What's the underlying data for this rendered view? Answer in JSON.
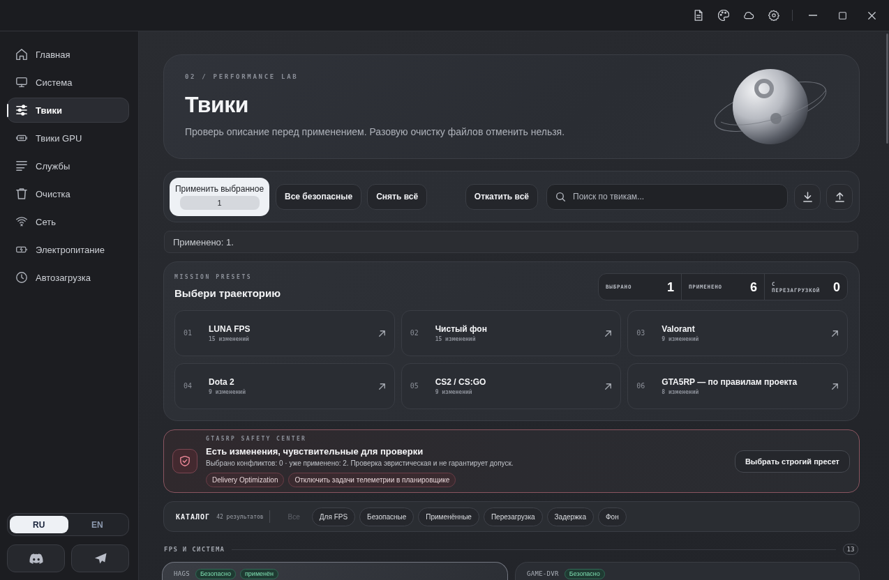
{
  "sidebar": {
    "items": [
      {
        "label": "Главная",
        "selected": false
      },
      {
        "label": "Система",
        "selected": false
      },
      {
        "label": "Твики",
        "selected": true
      },
      {
        "label": "Твики GPU",
        "selected": false
      },
      {
        "label": "Службы",
        "selected": false
      },
      {
        "label": "Очистка",
        "selected": false
      },
      {
        "label": "Сеть",
        "selected": false
      },
      {
        "label": "Электропитание",
        "selected": false
      },
      {
        "label": "Автозагрузка",
        "selected": false
      }
    ],
    "languages": [
      {
        "label": "RU",
        "selected": true
      },
      {
        "label": "EN",
        "selected": false
      }
    ]
  },
  "hero": {
    "eyebrow": "02 / PERFORMANCE LAB",
    "title": "Твики",
    "subtitle": "Проверь описание перед применением. Разовую очистку файлов отменить нельзя."
  },
  "toolbar": {
    "apply_button": {
      "label": "Применить выбранное",
      "count": "1"
    },
    "buttons": [
      "Все безопасные",
      "Снять всё"
    ],
    "revert_button": "Откатить всё",
    "search": {
      "placeholder": "Поиск по твикам..."
    }
  },
  "status_bar": "Применено: 1.",
  "presets": {
    "eyebrow": "MISSION PRESETS",
    "title": "Выбери траекторию",
    "stats": [
      {
        "label": "ВЫБРАНО",
        "value": "1"
      },
      {
        "label": "ПРИМЕНЕНО",
        "value": "6"
      },
      {
        "label": "С ПЕРЕЗАГРУЗКОЙ",
        "value": "0"
      }
    ],
    "items": [
      {
        "number": "01",
        "name": "LUNA FPS",
        "changes": "15 изменений"
      },
      {
        "number": "02",
        "name": "Чистый фон",
        "changes": "15 изменений"
      },
      {
        "number": "03",
        "name": "Valorant",
        "changes": "9 изменений"
      },
      {
        "number": "04",
        "name": "Dota 2",
        "changes": "9 изменений"
      },
      {
        "number": "05",
        "name": "CS2 / CS:GO",
        "changes": "9 изменений"
      },
      {
        "number": "06",
        "name": "GTA5RP — по правилам проекта",
        "changes": "8 изменений"
      }
    ]
  },
  "safety_center": {
    "eyebrow": "GTA5RP SAFETY CENTER",
    "title": "Есть изменения, чувствительные для проверки",
    "description": "Выбрано конфликтов: 0 · уже применено: 2. Проверка эвристическая и не гарантирует допуск.",
    "tags": [
      "Delivery Optimization",
      "Отключить задачи телеметрии в планировщике"
    ],
    "button": "Выбрать строгий пресет"
  },
  "catalog": {
    "title": "КАТАЛОГ",
    "count": "42 результатов",
    "filters": [
      {
        "label": "Все",
        "selected": true
      },
      {
        "label": "Для FPS",
        "selected": false
      },
      {
        "label": "Безопасные",
        "selected": false
      },
      {
        "label": "Применённые",
        "selected": false
      },
      {
        "label": "Перезагрузка",
        "selected": false
      },
      {
        "label": "Задержка",
        "selected": false
      },
      {
        "label": "Фон",
        "selected": false
      }
    ]
  },
  "section": {
    "title": "FPS И СИСТЕМА",
    "count": "13",
    "cards": [
      {
        "code": "HAGS",
        "selected": true,
        "tags": [
          "Безопасно",
          "применён"
        ]
      },
      {
        "code": "GAME-DVR",
        "selected": false,
        "tags": [
          "Безопасно"
        ]
      }
    ]
  }
}
